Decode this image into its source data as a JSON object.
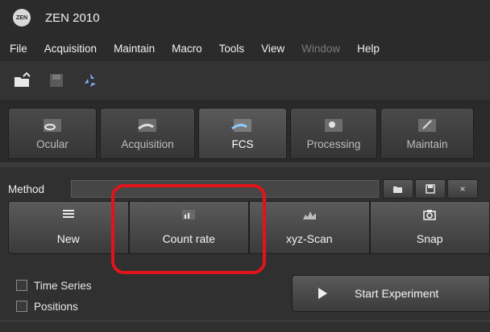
{
  "app": {
    "logo_text": "ZEN",
    "title": "ZEN 2010"
  },
  "menu": [
    {
      "label": "File",
      "disabled": false
    },
    {
      "label": "Acquisition",
      "disabled": false
    },
    {
      "label": "Maintain",
      "disabled": false
    },
    {
      "label": "Macro",
      "disabled": false
    },
    {
      "label": "Tools",
      "disabled": false
    },
    {
      "label": "View",
      "disabled": false
    },
    {
      "label": "Window",
      "disabled": true
    },
    {
      "label": "Help",
      "disabled": false
    }
  ],
  "toolbar": {
    "icons": [
      "open-folder-icon",
      "save-disk-icon",
      "recycle-icon"
    ]
  },
  "tabs": [
    {
      "label": "Ocular",
      "icon": "ocular-icon",
      "active": false
    },
    {
      "label": "Acquisition",
      "icon": "acquisition-icon",
      "active": false
    },
    {
      "label": "FCS",
      "icon": "fcs-icon",
      "active": true
    },
    {
      "label": "Processing",
      "icon": "processing-gear-icon",
      "active": false
    },
    {
      "label": "Maintain",
      "icon": "maintain-icon",
      "active": false
    }
  ],
  "method": {
    "label": "Method",
    "value": "",
    "buttons": [
      "open-folder-icon",
      "save-disk-icon",
      "close-icon"
    ],
    "close_glyph": "×"
  },
  "actions": [
    {
      "label": "New",
      "icon": "list-lines-icon"
    },
    {
      "label": "Count rate",
      "icon": "bar-chart-icon"
    },
    {
      "label": "xyz-Scan",
      "icon": "scan-histogram-icon"
    },
    {
      "label": "Snap",
      "icon": "camera-icon"
    }
  ],
  "options": [
    {
      "label": "Time Series",
      "checked": false
    },
    {
      "label": "Positions",
      "checked": false
    }
  ],
  "start": {
    "label": "Start Experiment",
    "icon": "play-icon"
  },
  "colors": {
    "background": "#2f2f2f",
    "highlight": "#e0141a",
    "text": "#f0f0f0"
  }
}
